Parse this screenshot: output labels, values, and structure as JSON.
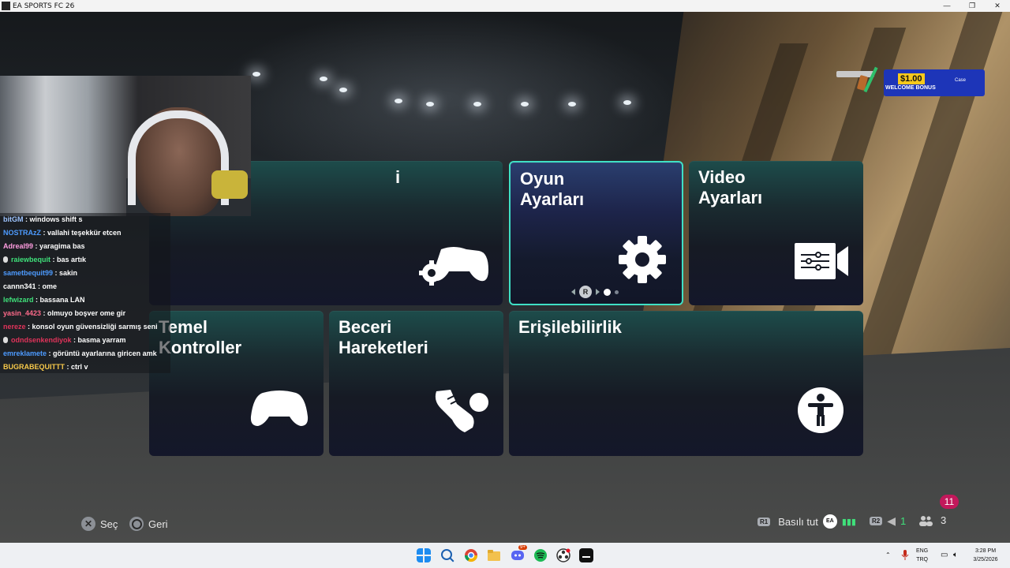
{
  "window": {
    "title": "EA SPORTS FC 26",
    "controls": [
      "—",
      "❐",
      "✕"
    ]
  },
  "menu": {
    "tiles": [
      {
        "id": "controller-settings",
        "label": "i",
        "icon": "gamepad-gear-icon"
      },
      {
        "id": "game-settings",
        "label": "Oyun\nAyarları",
        "icon": "gear-icon",
        "selected": true
      },
      {
        "id": "video-settings",
        "label": "Video\nAyarları",
        "icon": "video-settings-icon"
      },
      {
        "id": "basic-controls",
        "label": "Temel\nKontroller",
        "icon": "gamepad-icon"
      },
      {
        "id": "skill-moves",
        "label": "Beceri\nHareketleri",
        "icon": "boot-ball-icon"
      },
      {
        "id": "accessibility",
        "label": "Erişilebilirlik",
        "icon": "accessibility-icon"
      }
    ],
    "pager_button": "R"
  },
  "chat": {
    "messages": [
      {
        "user": "bitGM",
        "color": "#9fc5ff",
        "text": "windows shift s"
      },
      {
        "user": "NOSTRAzZ",
        "color": "#4d9bff",
        "text": "vallahi teşekkür etcen"
      },
      {
        "user": "Adreal99",
        "color": "#ff9de0",
        "text": "yaragima bas"
      },
      {
        "user": "raiewbequit",
        "color": "#3fe07a",
        "text": "bas artık",
        "badge": true
      },
      {
        "user": "sametbequit99",
        "color": "#4d9bff",
        "text": "sakin"
      },
      {
        "user": "cannn341",
        "color": "#ffffff",
        "text": "ome"
      },
      {
        "user": "lefwizard",
        "color": "#3fe07a",
        "text": "bassana LAN"
      },
      {
        "user": "yasin_4423",
        "color": "#ff6a8a",
        "text": "olmuyo boşver ome gir"
      },
      {
        "user": "nereze",
        "color": "#e0335a",
        "text": "konsol oyun güvensizliği sarmış seni"
      },
      {
        "user": "odndsenkendiyok",
        "color": "#e0335a",
        "text": "basma yarram",
        "badge": true
      },
      {
        "user": "emreklamete",
        "color": "#4d9bff",
        "text": "görüntü ayarlarına giricen amk"
      },
      {
        "user": "BUGRABEQUITTT",
        "color": "#f7c94a",
        "text": "ctrl v"
      }
    ]
  },
  "ad": {
    "amount": "$1.00",
    "text": "WELCOME BONUS",
    "brand": "Case"
  },
  "hints": {
    "select_label": "Seç",
    "back_label": "Geri",
    "r1_badge": "R1",
    "hold_label": "Basılı tut",
    "ea_label": "EA",
    "r2_badge": "R2",
    "volume_count": "1",
    "friends_count": "3",
    "notification_count": "11"
  },
  "taskbar": {
    "lang_top": "ENG",
    "lang_bottom": "TRQ",
    "time": "3:28 PM",
    "date": "3/25/2026",
    "discord_badge": "9+"
  },
  "colors": {
    "accent": "#3fe0c5",
    "notification": "#c2185b"
  }
}
